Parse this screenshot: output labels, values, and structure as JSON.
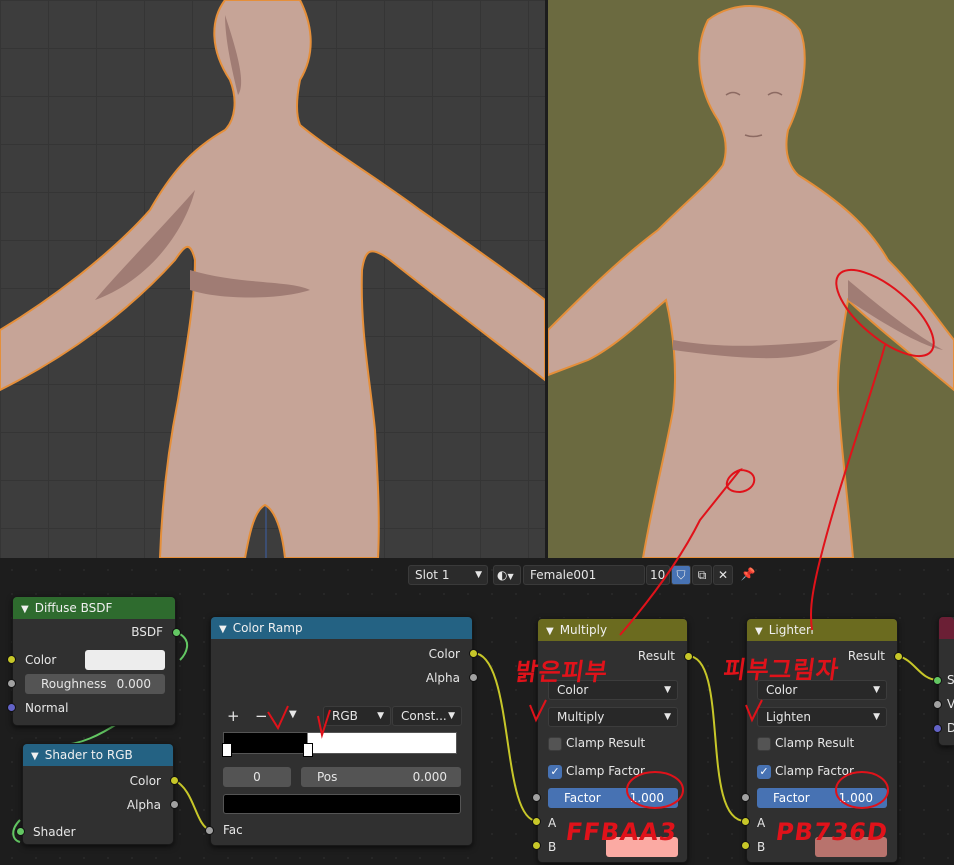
{
  "header": {
    "slot": "Slot 1",
    "material_name": "Female001",
    "user_count": "10"
  },
  "colors": {
    "diffuse_header": "#2e6b2e",
    "shader_to_rgb_header": "#246283",
    "color_ramp_header": "#246283",
    "mix_header": "#6b6b1f",
    "output_header": "#6b1f35",
    "annotation": "#e0121a",
    "multiply_swatch": "#fbaaa3",
    "lighten_swatch": "#b8736d"
  },
  "nodes": {
    "diffuse": {
      "title": "Diffuse BSDF",
      "out_bsdf": "BSDF",
      "color_label": "Color",
      "roughness_label": "Roughness",
      "roughness_value": "0.000",
      "normal_label": "Normal"
    },
    "shader_to_rgb": {
      "title": "Shader to RGB",
      "out_color": "Color",
      "out_alpha": "Alpha",
      "in_shader": "Shader"
    },
    "color_ramp": {
      "title": "Color Ramp",
      "out_color": "Color",
      "out_alpha": "Alpha",
      "add": "+",
      "remove": "−",
      "mode": "RGB",
      "interp": "Const...",
      "index": "0",
      "pos_label": "Pos",
      "pos_value": "0.000",
      "in_fac": "Fac"
    },
    "multiply": {
      "title": "Multiply",
      "out_result": "Result",
      "data_type": "Color",
      "blend": "Multiply",
      "clamp_result": "Clamp Result",
      "clamp_factor": "Clamp Factor",
      "factor_label": "Factor",
      "factor_value": "1.000",
      "in_a": "A",
      "in_b": "B"
    },
    "lighten": {
      "title": "Lighten",
      "out_result": "Result",
      "data_type": "Color",
      "blend": "Lighten",
      "clamp_result": "Clamp Result",
      "clamp_factor": "Clamp Factor",
      "factor_label": "Factor",
      "factor_value": "1.000",
      "in_a": "A",
      "in_b": "B"
    },
    "output_partial": {
      "in_s": "S",
      "in_v": "V",
      "in_d": "D"
    }
  },
  "annotations": {
    "bright_skin": "밝은피부",
    "skin_shadow": "피부그림자",
    "hex_bright": "FFBAA3",
    "hex_shadow": "PB736D"
  }
}
